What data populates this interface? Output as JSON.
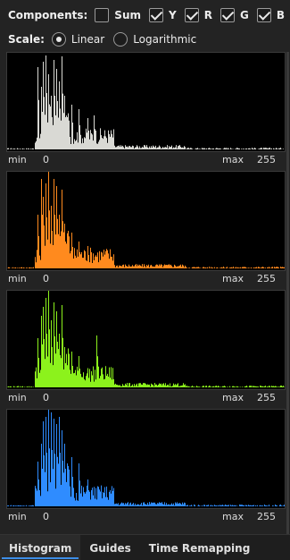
{
  "components": {
    "label": "Components:",
    "items": [
      {
        "label": "Sum",
        "checked": false
      },
      {
        "label": "Y",
        "checked": true
      },
      {
        "label": "R",
        "checked": true
      },
      {
        "label": "G",
        "checked": true
      },
      {
        "label": "B",
        "checked": true
      }
    ]
  },
  "scale": {
    "label": "Scale:",
    "options": [
      {
        "label": "Linear",
        "selected": true
      },
      {
        "label": "Logarithmic",
        "selected": false
      }
    ]
  },
  "axis": {
    "min_label": "min",
    "min_value": "0",
    "max_label": "max",
    "max_value": "255"
  },
  "histograms": [
    {
      "channel": "Y",
      "color": "#d9d9d4"
    },
    {
      "channel": "R",
      "color": "#ff8a1e"
    },
    {
      "channel": "G",
      "color": "#8cf21c"
    },
    {
      "channel": "B",
      "color": "#2f8cff"
    }
  ],
  "tabs": [
    {
      "label": "Histogram",
      "active": true
    },
    {
      "label": "Guides",
      "active": false
    },
    {
      "label": "Time Remapping",
      "active": false
    }
  ]
}
